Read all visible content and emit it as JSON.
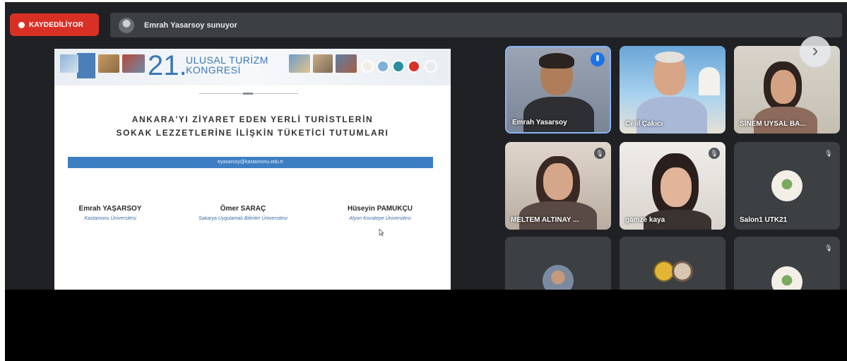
{
  "top_bar": {
    "recording_label": "KAYDEDİLİYOR",
    "presenter_text": "Emrah Yasarsoy sunuyor"
  },
  "slide": {
    "banner": {
      "edition": "21.",
      "title_line1": "ULUSAL TURİZM",
      "title_line2": "KONGRESİ"
    },
    "title_line1": "ANKARA'YI ZİYARET EDEN YERLİ TURİSTLERİN",
    "title_line2": "SOKAK LEZZETLERİNE İLİŞKİN TÜKETİCİ TUTUMLARI",
    "email": "eyasarsoy@kastamonu.edu.tr",
    "authors": [
      {
        "name": "Emrah YAŞARSOY",
        "affiliation": "Kastamonu Üniversitesi"
      },
      {
        "name": "Ömer SARAÇ",
        "affiliation": "Sakarya Uygulamalı Bilimler Üniversitesi"
      },
      {
        "name": "Hüseyin PAMUKÇU",
        "affiliation": "Afyon Kocatepe Üniversitesi"
      }
    ]
  },
  "participants": [
    {
      "name": "Emrah Yasarsoy",
      "state": "speaking"
    },
    {
      "name": "Celil Çakıcı",
      "state": "video"
    },
    {
      "name": "SİNEM UYSAL BA...",
      "state": "video"
    },
    {
      "name": "MELTEM ALTINAY ...",
      "state": "muted"
    },
    {
      "name": "gamze kaya",
      "state": "muted"
    },
    {
      "name": "Salon1 UTK21",
      "state": "muted"
    },
    {
      "name": "",
      "state": "video"
    },
    {
      "name": "",
      "state": "video"
    },
    {
      "name": "",
      "state": "muted"
    }
  ],
  "icons": {
    "record": "record-dot-icon",
    "next": "chevron-right-icon",
    "mic_off": "mic-off-icon",
    "speaking": "audio-wave-icon"
  },
  "colors": {
    "record_red": "#d93025",
    "meet_dark": "#202124",
    "tile_bg": "#3c4043",
    "slide_accent": "#3d7ec2"
  }
}
